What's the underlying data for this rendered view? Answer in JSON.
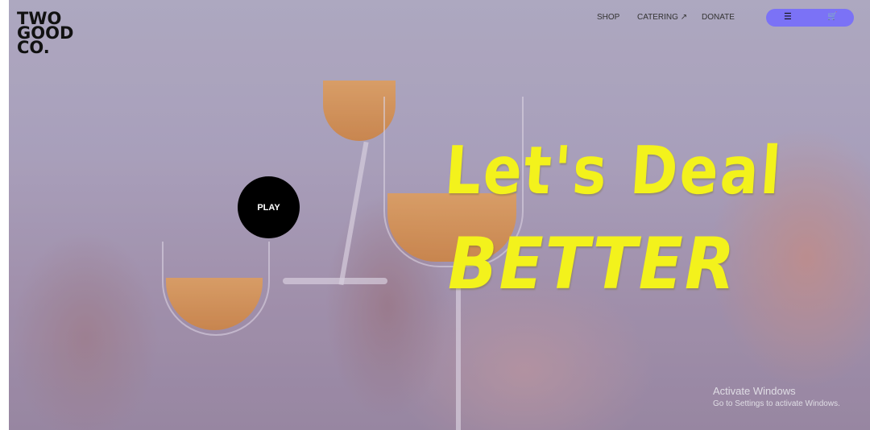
{
  "brand": {
    "line1": "TWO",
    "line2": "GOOD",
    "line3": "CO."
  },
  "nav": {
    "shop": "SHOP",
    "catering": "CATERING ↗",
    "donate": "DONATE"
  },
  "menu": {
    "menu_icon": "☰",
    "cart_icon": "🛒"
  },
  "play_label": "PLAY",
  "hero": {
    "line1": "Let's Deal",
    "line2": "BETTER"
  },
  "watermark": {
    "title": "Activate Windows",
    "subtitle": "Go to Settings to activate Windows."
  },
  "colors": {
    "accent": "#7b72f6",
    "headline": "#f3f21c",
    "play_bg": "#000000"
  }
}
